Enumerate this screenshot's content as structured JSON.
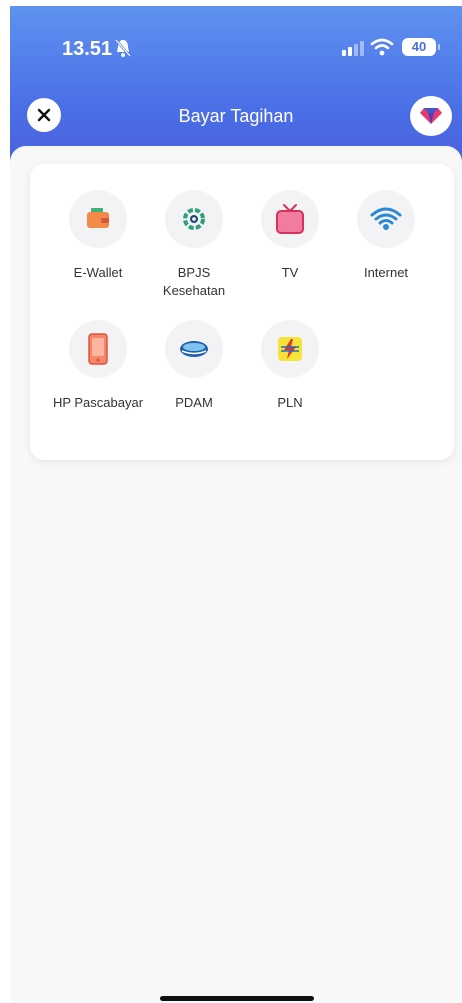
{
  "status_bar": {
    "time": "13.51",
    "battery": "40"
  },
  "header": {
    "title": "Bayar Tagihan"
  },
  "icons": {
    "close": "close-icon",
    "gem": "diamond-icon"
  },
  "colors": {
    "header_top": "#5f92f0",
    "header_bottom": "#4a5ad8",
    "background": "#f8f8f8"
  },
  "categories": [
    {
      "label": "E-Wallet",
      "icon": "wallet-icon"
    },
    {
      "label": "BPJS",
      "label2": "Kesehatan",
      "icon": "bpjs-icon"
    },
    {
      "label": "TV",
      "icon": "tv-icon"
    },
    {
      "label": "Internet",
      "icon": "wifi-icon"
    },
    {
      "label": "HP Pascabayar",
      "icon": "phone-icon"
    },
    {
      "label": "PDAM",
      "icon": "pdam-icon"
    },
    {
      "label": "PLN",
      "icon": "pln-icon"
    }
  ]
}
